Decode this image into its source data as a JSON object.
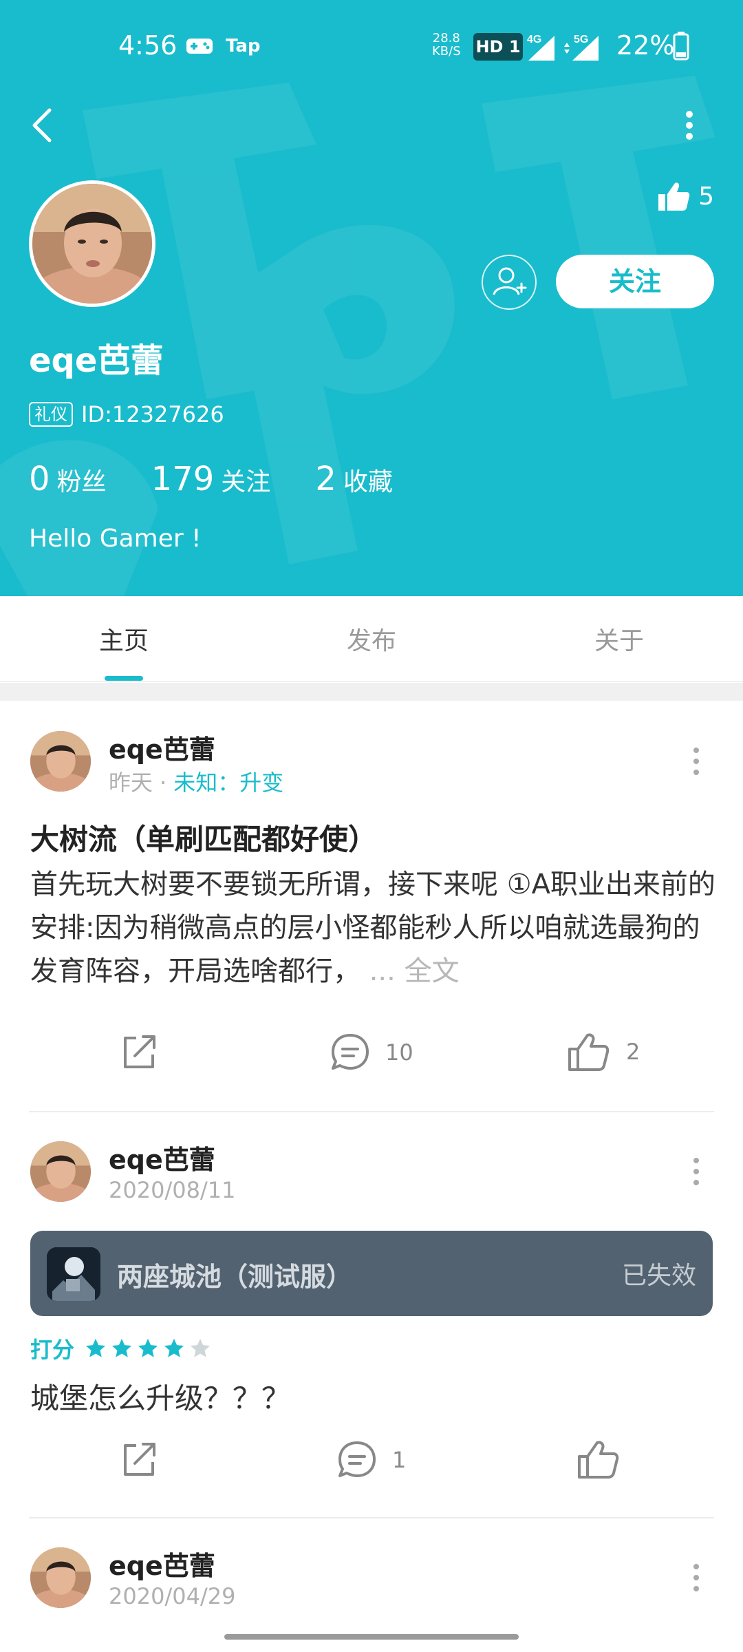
{
  "status_bar": {
    "time": "4:56",
    "tap_label": "Tap",
    "net_speed_value": "28.8",
    "net_speed_unit": "KB/S",
    "hd_label": "HD 1",
    "signal1_label": "4G",
    "signal2_label": "5G",
    "battery": "22%"
  },
  "profile": {
    "likes_count": "5",
    "follow_button": "关注",
    "name": "eqe芭蕾",
    "badge": "礼仪",
    "uid": "ID:12327626",
    "stats": [
      {
        "num": "0",
        "label": "粉丝"
      },
      {
        "num": "179",
        "label": "关注"
      },
      {
        "num": "2",
        "label": "收藏"
      }
    ],
    "bio": "Hello Gamer !"
  },
  "tabs": [
    {
      "label": "主页",
      "active": true
    },
    {
      "label": "发布",
      "active": false
    },
    {
      "label": "关于",
      "active": false
    }
  ],
  "posts": [
    {
      "author": "eqe芭蕾",
      "time": "昨天",
      "separator": "·",
      "tag": "未知：升变",
      "title": "大树流（单刷匹配都好使）",
      "body": "首先玩大树要不要锁无所谓，接下来呢 ①A职业出来前的安排:因为稍微高点的层小怪都能秒人所以咱就选最狗的发育阵容，开局选啥都行，",
      "more_label": "... 全文",
      "comments": "10",
      "likes": "2"
    },
    {
      "author": "eqe芭蕾",
      "time": "2020/08/11",
      "game_name": "两座城池（测试服）",
      "game_status": "已失效",
      "rating_label": "打分",
      "rating": 4,
      "rating_max": 5,
      "text": "城堡怎么升级？？？",
      "comments": "1",
      "likes": ""
    },
    {
      "author": "eqe芭蕾",
      "time": "2020/04/29"
    }
  ],
  "colors": {
    "brand": "#19bccc",
    "game_card": "#526270",
    "star_empty": "#cfd6da"
  }
}
